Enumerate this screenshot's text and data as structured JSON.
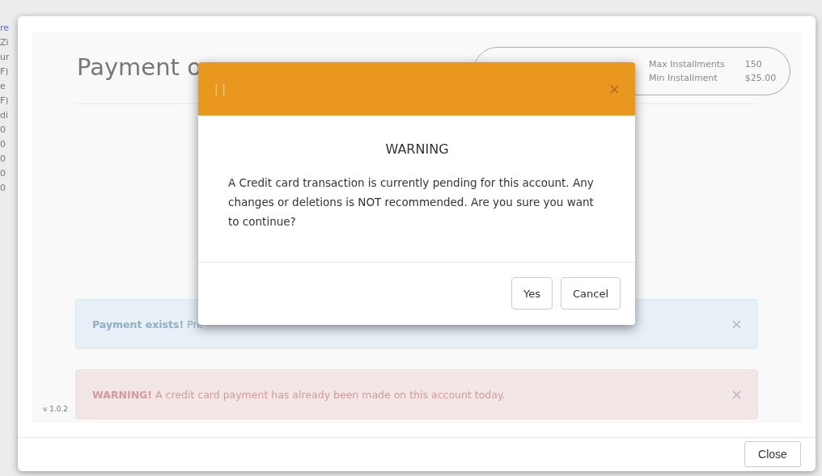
{
  "background_fragments": [
    {
      "text": "re",
      "kind": "link"
    },
    {
      "text": "Zi",
      "kind": "text"
    },
    {
      "text": "ur",
      "kind": "text"
    },
    {
      "text": "F)",
      "kind": "text"
    },
    {
      "text": "e",
      "kind": "text"
    },
    {
      "text": "F)",
      "kind": "text"
    },
    {
      "text": "di",
      "kind": "text"
    },
    {
      "text": "0",
      "kind": "cell"
    },
    {
      "text": "0",
      "kind": "cell"
    },
    {
      "text": "0",
      "kind": "cell"
    },
    {
      "text": "0",
      "kind": "cell"
    },
    {
      "text": "0",
      "kind": "cell"
    }
  ],
  "modal": {
    "title": "Payment o",
    "summary": [
      {
        "label": "Max Installments",
        "value": "150"
      },
      {
        "label": "Min Installment",
        "value": "$25.00"
      }
    ],
    "alerts": [
      {
        "kind": "info",
        "text": "**Payment exists!** Pre"
      },
      {
        "kind": "danger",
        "text": "**WARNING!** A credit card payment has already been made on this account today."
      }
    ],
    "version": "v 1.0.2",
    "close_button": "Close"
  },
  "dialog": {
    "header": "| |",
    "heading": "WARNING",
    "message": "A Credit card transaction is currently pending for this account. Any changes or deletions is NOT recommended. Are you sure you want to continue?",
    "buttons": [
      "Yes",
      "Cancel"
    ]
  }
}
